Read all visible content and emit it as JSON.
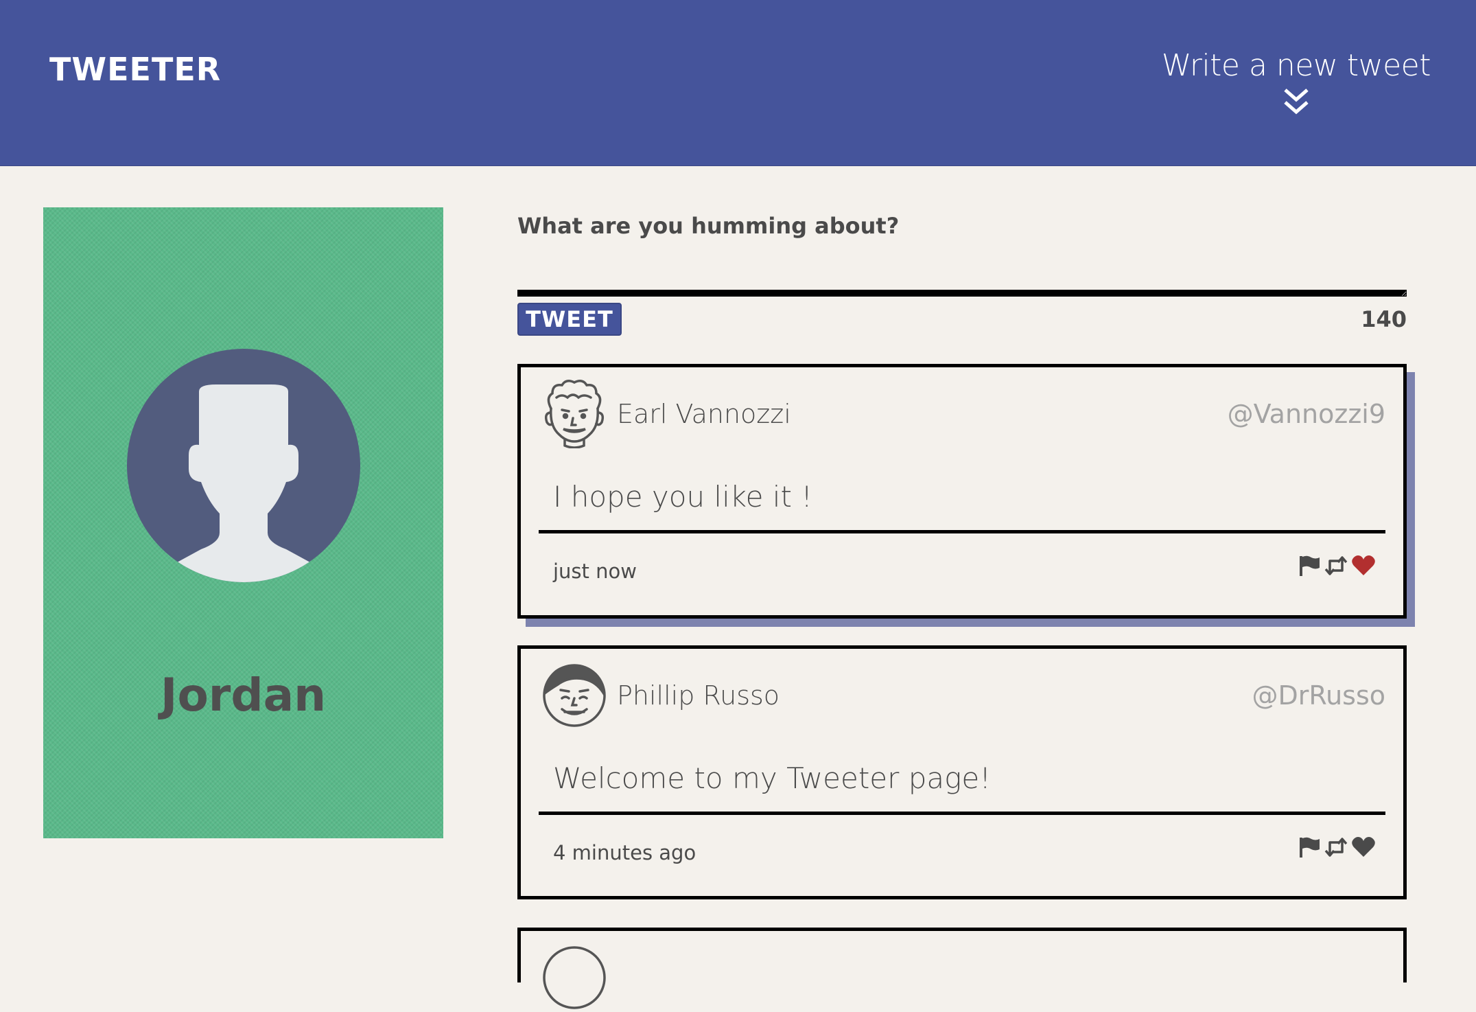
{
  "nav": {
    "brand": "TWEETER",
    "compose_label": "Write a new tweet",
    "compose_icon": "double-chevron-down-icon"
  },
  "profile": {
    "name": "Jordan",
    "avatar_icon": "user-silhouette-icon"
  },
  "composer": {
    "question": "What are you humming about?",
    "text_value": "",
    "button_label": "TWEET",
    "char_counter": "140"
  },
  "tweets": [
    {
      "name": "Earl Vannozzi",
      "handle": "@Vannozzi9",
      "text": "I hope you like it !",
      "time": "just now",
      "liked": true
    },
    {
      "name": "Phillip Russo",
      "handle": "@DrRusso",
      "text": "Welcome to my Tweeter page!",
      "time": "4 minutes ago",
      "liked": false
    }
  ],
  "colors": {
    "nav_background": "#45549b",
    "page_background": "#f4f1ec",
    "profile_background": "#5ab98a",
    "card_shadow": "#7d83ae",
    "liked_heart": "#b22f2f",
    "icon_gray": "#4a4a4a"
  }
}
